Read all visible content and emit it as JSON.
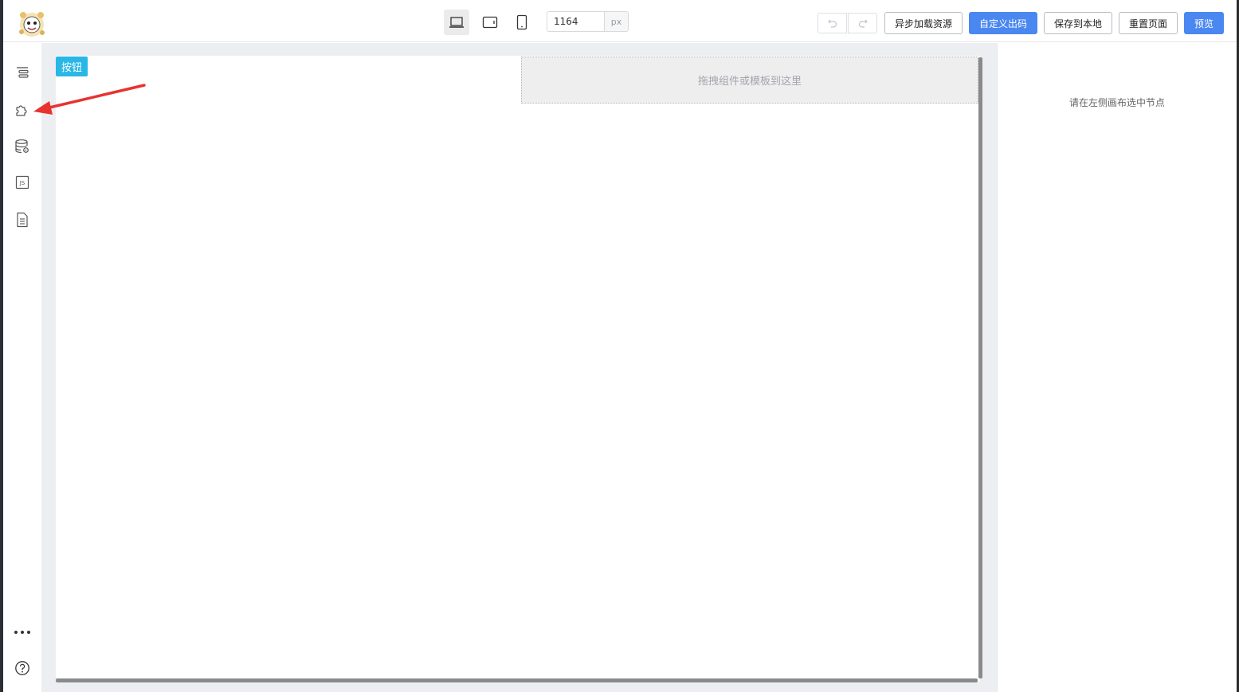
{
  "toolbar": {
    "device_modes": [
      {
        "icon": "laptop-icon",
        "active": true
      },
      {
        "icon": "tablet-icon",
        "active": false
      },
      {
        "icon": "phone-icon",
        "active": false
      }
    ],
    "canvas_width": "1164",
    "canvas_width_unit": "px",
    "undo_icon": "undo-icon",
    "redo_icon": "redo-icon",
    "async_load_label": "异步加载资源",
    "custom_code_label": "自定义出码",
    "save_local_label": "保存到本地",
    "reset_page_label": "重置页面",
    "preview_label": "预览"
  },
  "sidebar": {
    "items": [
      {
        "icon": "outline-tree-icon"
      },
      {
        "icon": "component-puzzle-icon"
      },
      {
        "icon": "datasource-icon"
      },
      {
        "icon": "js-code-icon"
      },
      {
        "icon": "schema-document-icon"
      }
    ],
    "bottom_items": [
      {
        "icon": "more-icon"
      },
      {
        "icon": "help-icon"
      }
    ]
  },
  "canvas": {
    "selected_tag": "按钮",
    "dropzone_text": "拖拽组件或模板到这里"
  },
  "right_panel": {
    "hint": "请在左侧画布选中节点"
  },
  "colors": {
    "primary": "#4a87f0",
    "tag": "#29b7e6",
    "annotation_arrow": "#e8322f"
  }
}
